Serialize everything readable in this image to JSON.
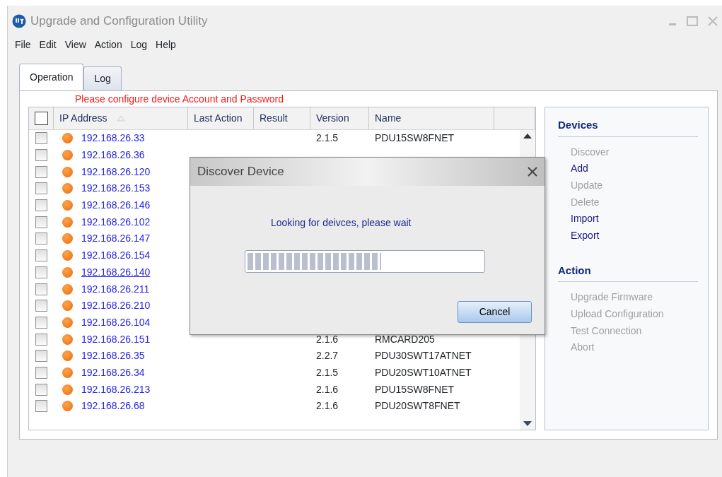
{
  "window": {
    "title": "Upgrade and Configuration Utility"
  },
  "menu": [
    "File",
    "Edit",
    "View",
    "Action",
    "Log",
    "Help"
  ],
  "tabs": [
    {
      "label": "Operation",
      "selected": true
    },
    {
      "label": "Log",
      "selected": false
    }
  ],
  "notice": "Please configure device Account and Password",
  "table": {
    "select_all": {
      "checked": false
    },
    "columns": [
      {
        "label": "IP Address",
        "sorted": true
      },
      {
        "label": "Last Action",
        "sorted": false
      },
      {
        "label": "Result",
        "sorted": false
      },
      {
        "label": "Version",
        "sorted": false
      },
      {
        "label": "Name",
        "sorted": false
      }
    ],
    "rows": [
      {
        "checked": false,
        "hovered": false,
        "ip": "192.168.26.33",
        "version": "2.1.5",
        "name": "PDU15SW8FNET"
      },
      {
        "checked": false,
        "hovered": false,
        "ip": "192.168.26.36"
      },
      {
        "checked": false,
        "hovered": false,
        "ip": "192.168.26.120"
      },
      {
        "checked": false,
        "hovered": false,
        "ip": "192.168.26.153"
      },
      {
        "checked": false,
        "hovered": false,
        "ip": "192.168.26.146"
      },
      {
        "checked": false,
        "hovered": false,
        "ip": "192.168.26.102"
      },
      {
        "checked": false,
        "hovered": false,
        "ip": "192.168.26.147"
      },
      {
        "checked": false,
        "hovered": false,
        "ip": "192.168.26.154"
      },
      {
        "checked": false,
        "hovered": true,
        "ip": "192.168.26.140"
      },
      {
        "checked": false,
        "hovered": false,
        "ip": "192.168.26.211"
      },
      {
        "checked": false,
        "hovered": false,
        "ip": "192.168.26.210"
      },
      {
        "checked": false,
        "hovered": false,
        "ip": "192.168.26.104"
      },
      {
        "checked": false,
        "hovered": false,
        "ip": "192.168.26.151",
        "version": "2.1.6",
        "name": "RMCARD205"
      },
      {
        "checked": false,
        "hovered": false,
        "ip": "192.168.26.35",
        "version": "2.2.7",
        "name": "PDU30SWT17ATNET"
      },
      {
        "checked": false,
        "hovered": false,
        "ip": "192.168.26.34",
        "version": "2.1.5",
        "name": "PDU20SWT10ATNET"
      },
      {
        "checked": false,
        "hovered": false,
        "ip": "192.168.26.213",
        "version": "2.1.6",
        "name": "PDU15SW8FNET"
      },
      {
        "checked": false,
        "hovered": false,
        "ip": "192.168.26.68",
        "version": "2.1.6",
        "name": "PDU20SWT8FNET"
      }
    ]
  },
  "side_panel": [
    {
      "title": "Devices",
      "items": [
        {
          "label": "Discover",
          "disabled": true
        },
        {
          "label": "Add",
          "disabled": false
        },
        {
          "label": "Update",
          "disabled": true
        },
        {
          "label": "Delete",
          "disabled": true
        },
        {
          "label": "Import",
          "disabled": false
        },
        {
          "label": "Export",
          "disabled": false
        }
      ]
    },
    {
      "title": "Action",
      "items": [
        {
          "label": "Upgrade Firmware",
          "disabled": true
        },
        {
          "label": "Upload Configuration",
          "disabled": true
        },
        {
          "label": "Test Connection",
          "disabled": true
        },
        {
          "label": "Abort",
          "disabled": true
        }
      ]
    }
  ],
  "dialog": {
    "title": "Discover Device",
    "message": "Looking for deivces, please wait",
    "progress": {
      "level": 0.57
    },
    "buttons": [
      "Cancel"
    ]
  }
}
